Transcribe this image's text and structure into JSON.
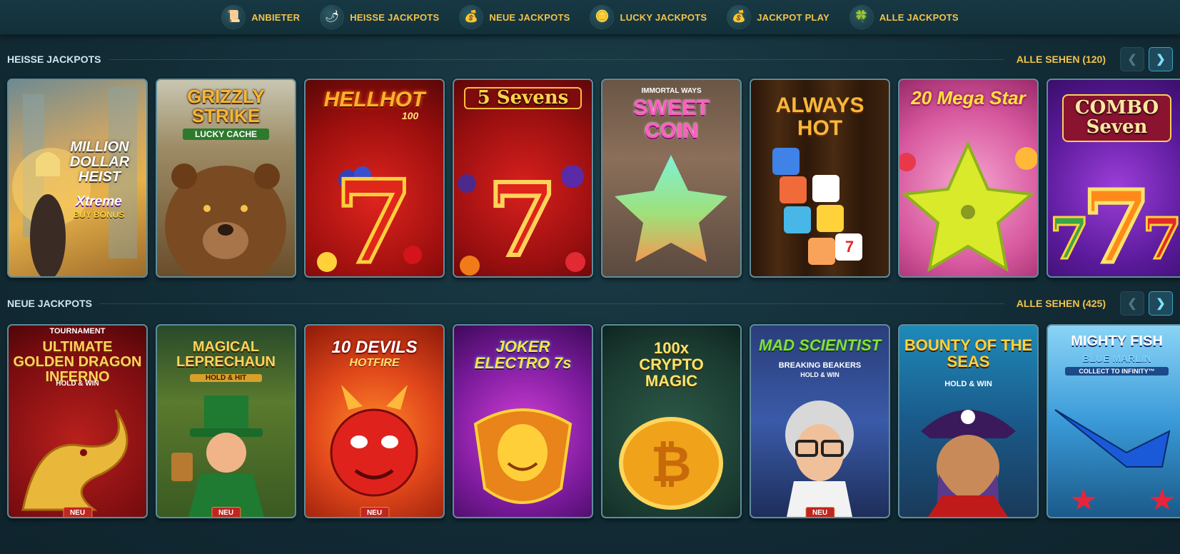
{
  "nav": [
    {
      "label": "ANBIETER",
      "icon": "scroll-icon",
      "glyph": "📜"
    },
    {
      "label": "HEISSE JACKPOTS",
      "icon": "chili-icon",
      "glyph": "🌶"
    },
    {
      "label": "NEUE JACKPOTS",
      "icon": "money-bag-icon",
      "glyph": "💰"
    },
    {
      "label": "LUCKY JACKPOTS",
      "icon": "coins-icon",
      "glyph": "🪙"
    },
    {
      "label": "JACKPOT PLAY",
      "icon": "coin-bag-icon",
      "glyph": "💰"
    },
    {
      "label": "ALLE JACKPOTS",
      "icon": "clover-icon",
      "glyph": "🍀"
    }
  ],
  "sections": [
    {
      "title": "HEISSE JACKPOTS",
      "see_all": "ALLE SEHEN (120)",
      "prev_glyph": "❮",
      "next_glyph": "❯",
      "games": [
        {
          "title": "MILLION DOLLAR HEIST",
          "sub": "Xtreme",
          "sub2": "BUY BONUS",
          "badge": ""
        },
        {
          "title": "GRIZZLY STRIKE",
          "sub": "LUCKY CACHE",
          "sub2": "",
          "badge": ""
        },
        {
          "title": "HELLHOT",
          "sub": "100",
          "sub2": "",
          "badge": ""
        },
        {
          "title": "5 Sevens",
          "sub": "",
          "sub2": "",
          "badge": ""
        },
        {
          "title": "SWEET COIN",
          "sub": "IMMORTAL WAYS",
          "sub2": "",
          "badge": ""
        },
        {
          "title": "ALWAYS HOT",
          "sub": "",
          "sub2": "",
          "badge": ""
        },
        {
          "title": "20 Mega Star",
          "sub": "",
          "sub2": "",
          "badge": ""
        },
        {
          "title": "COMBO Seven",
          "sub": "",
          "sub2": "",
          "badge": ""
        }
      ]
    },
    {
      "title": "NEUE JACKPOTS",
      "see_all": "ALLE SEHEN (425)",
      "prev_glyph": "❮",
      "next_glyph": "❯",
      "games": [
        {
          "title": "ULTIMATE GOLDEN DRAGON INFERNO",
          "sub": "TOURNAMENT",
          "sub2": "HOLD & WIN",
          "badge": "NEU"
        },
        {
          "title": "MAGICAL LEPRECHAUN",
          "sub": "HOLD & HIT",
          "sub2": "",
          "badge": "NEU"
        },
        {
          "title": "10 DEVILS",
          "sub": "HOTFIRE",
          "sub2": "",
          "badge": "NEU"
        },
        {
          "title": "JOKER ELECTRO 7s",
          "sub": "",
          "sub2": "",
          "badge": ""
        },
        {
          "title": "100x CRYPTO MAGIC",
          "sub": "",
          "sub2": "",
          "badge": ""
        },
        {
          "title": "MAD SCIENTIST",
          "sub": "BREAKING BEAKERS",
          "sub2": "HOLD & WIN",
          "badge": "NEU"
        },
        {
          "title": "BOUNTY OF THE SEAS",
          "sub": "HOLD & WIN",
          "sub2": "",
          "badge": ""
        },
        {
          "title": "MIGHTY FISH",
          "sub": "BLUE MARLIN",
          "sub2": "COLLECT TO INFINITY™",
          "badge": ""
        }
      ]
    }
  ]
}
